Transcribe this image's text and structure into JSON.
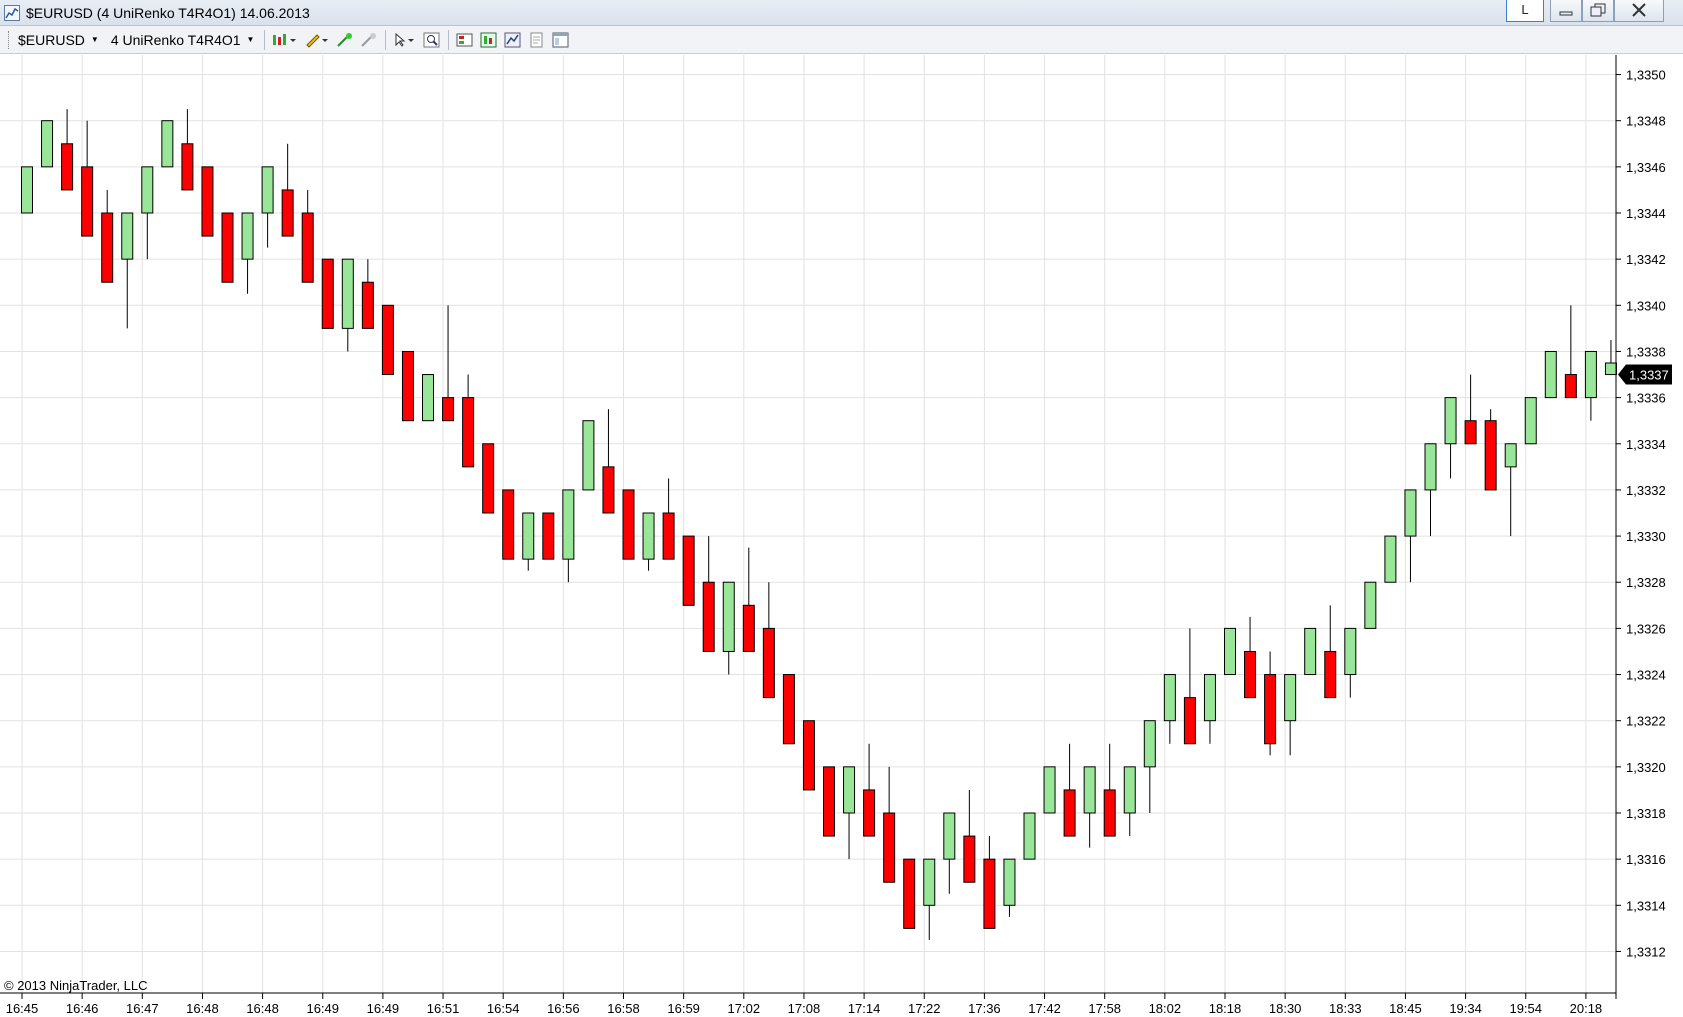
{
  "window": {
    "title": "$EURUSD (4 UniRenko T4R4O1)  14.06.2013",
    "buttons": {
      "layout": "L"
    }
  },
  "toolbar": {
    "instrument": "$EURUSD",
    "bar_type": "4 UniRenko T4R4O1",
    "icons": [
      "bar-style-icon",
      "drawing-pencil-icon",
      "add-marker-icon",
      "remove-marker-icon",
      "pointer-icon",
      "zoom-icon",
      "data-box-icon",
      "strategies-icon",
      "indicators-icon",
      "properties-icon",
      "layout-icon"
    ]
  },
  "footer": {
    "copyright": "© 2013 NinjaTrader, LLC"
  },
  "colors": {
    "up": "#99e699",
    "down": "#ff0000",
    "grid": "#e2e2e2",
    "last_price_bg": "#000000",
    "last_price_text": "#ffffff"
  },
  "chart_data": {
    "type": "candlestick",
    "ylim": [
      1.33115,
      1.33505
    ],
    "y_ticks": [
      "1,3312",
      "1,3314",
      "1,3316",
      "1,3318",
      "1,3320",
      "1,3322",
      "1,3324",
      "1,3326",
      "1,3328",
      "1,3330",
      "1,3332",
      "1,3334",
      "1,3336",
      "1,3338",
      "1,3340",
      "1,3342",
      "1,3344",
      "1,3346",
      "1,3348",
      "1,3350"
    ],
    "x_labels": [
      "16:45",
      "16:46",
      "16:47",
      "16:48",
      "16:48",
      "16:49",
      "16:49",
      "16:51",
      "16:54",
      "16:56",
      "16:58",
      "16:59",
      "17:02",
      "17:08",
      "17:14",
      "17:22",
      "17:36",
      "17:42",
      "17:58",
      "18:02",
      "18:18",
      "18:30",
      "18:33",
      "18:45",
      "19:34",
      "19:54",
      "20:18"
    ],
    "last_price": "1,3337",
    "last_price_value": 1.3337,
    "candles": [
      [
        1.3344,
        1.3346,
        1.3344,
        1.3346
      ],
      [
        1.3346,
        1.3348,
        1.3346,
        1.3348
      ],
      [
        1.3347,
        1.33485,
        1.3345,
        1.3345
      ],
      [
        1.3346,
        1.3348,
        1.3343,
        1.3343
      ],
      [
        1.3344,
        1.3345,
        1.3341,
        1.3341
      ],
      [
        1.3342,
        1.3344,
        1.3339,
        1.3344
      ],
      [
        1.3344,
        1.3346,
        1.3342,
        1.3346
      ],
      [
        1.3346,
        1.3348,
        1.3346,
        1.3348
      ],
      [
        1.3347,
        1.33485,
        1.3345,
        1.3345
      ],
      [
        1.3346,
        1.3346,
        1.3343,
        1.3343
      ],
      [
        1.3344,
        1.3344,
        1.3341,
        1.3341
      ],
      [
        1.3342,
        1.3344,
        1.33405,
        1.3344
      ],
      [
        1.3344,
        1.3346,
        1.33425,
        1.3346
      ],
      [
        1.3345,
        1.3347,
        1.3343,
        1.3343
      ],
      [
        1.3344,
        1.3345,
        1.3341,
        1.3341
      ],
      [
        1.3342,
        1.3342,
        1.3339,
        1.3339
      ],
      [
        1.3339,
        1.3342,
        1.3338,
        1.3342
      ],
      [
        1.3341,
        1.3342,
        1.3339,
        1.3339
      ],
      [
        1.334,
        1.334,
        1.3337,
        1.3337
      ],
      [
        1.3338,
        1.3338,
        1.3335,
        1.3335
      ],
      [
        1.3335,
        1.3337,
        1.3335,
        1.3337
      ],
      [
        1.3336,
        1.334,
        1.3335,
        1.3335
      ],
      [
        1.3336,
        1.3337,
        1.3333,
        1.3333
      ],
      [
        1.3334,
        1.3334,
        1.3331,
        1.3331
      ],
      [
        1.3332,
        1.3332,
        1.3329,
        1.3329
      ],
      [
        1.3329,
        1.3331,
        1.33285,
        1.3331
      ],
      [
        1.3331,
        1.3331,
        1.3329,
        1.3329
      ],
      [
        1.3329,
        1.3332,
        1.3328,
        1.3332
      ],
      [
        1.3332,
        1.3335,
        1.3332,
        1.3335
      ],
      [
        1.3333,
        1.33355,
        1.3331,
        1.3331
      ],
      [
        1.3332,
        1.3332,
        1.3329,
        1.3329
      ],
      [
        1.3329,
        1.3331,
        1.33285,
        1.3331
      ],
      [
        1.3331,
        1.33325,
        1.3329,
        1.3329
      ],
      [
        1.333,
        1.333,
        1.3327,
        1.3327
      ],
      [
        1.3328,
        1.333,
        1.3325,
        1.3325
      ],
      [
        1.3325,
        1.3328,
        1.3324,
        1.3328
      ],
      [
        1.3327,
        1.33295,
        1.3325,
        1.3325
      ],
      [
        1.3326,
        1.3328,
        1.3323,
        1.3323
      ],
      [
        1.3324,
        1.3324,
        1.3321,
        1.3321
      ],
      [
        1.3322,
        1.3322,
        1.3319,
        1.3319
      ],
      [
        1.332,
        1.332,
        1.3317,
        1.3317
      ],
      [
        1.3318,
        1.332,
        1.3316,
        1.332
      ],
      [
        1.3319,
        1.3321,
        1.3317,
        1.3317
      ],
      [
        1.3318,
        1.332,
        1.3315,
        1.3315
      ],
      [
        1.3316,
        1.3316,
        1.3313,
        1.3313
      ],
      [
        1.3314,
        1.3316,
        1.33125,
        1.3316
      ],
      [
        1.3316,
        1.3318,
        1.33145,
        1.3318
      ],
      [
        1.3317,
        1.3319,
        1.3315,
        1.3315
      ],
      [
        1.3316,
        1.3317,
        1.3313,
        1.3313
      ],
      [
        1.3314,
        1.3316,
        1.33135,
        1.3316
      ],
      [
        1.3316,
        1.3318,
        1.3316,
        1.3318
      ],
      [
        1.3318,
        1.332,
        1.3318,
        1.332
      ],
      [
        1.3319,
        1.3321,
        1.3317,
        1.3317
      ],
      [
        1.3318,
        1.332,
        1.33165,
        1.332
      ],
      [
        1.3319,
        1.3321,
        1.3317,
        1.3317
      ],
      [
        1.3318,
        1.332,
        1.3317,
        1.332
      ],
      [
        1.332,
        1.3322,
        1.3318,
        1.3322
      ],
      [
        1.3322,
        1.3324,
        1.3321,
        1.3324
      ],
      [
        1.3323,
        1.3326,
        1.3321,
        1.3321
      ],
      [
        1.3322,
        1.3324,
        1.3321,
        1.3324
      ],
      [
        1.3324,
        1.3326,
        1.3324,
        1.3326
      ],
      [
        1.3325,
        1.33265,
        1.3323,
        1.3323
      ],
      [
        1.3324,
        1.3325,
        1.33205,
        1.3321
      ],
      [
        1.3322,
        1.3324,
        1.33205,
        1.3324
      ],
      [
        1.3324,
        1.3326,
        1.3324,
        1.3326
      ],
      [
        1.3325,
        1.3327,
        1.3323,
        1.3323
      ],
      [
        1.3324,
        1.3326,
        1.3323,
        1.3326
      ],
      [
        1.3326,
        1.3328,
        1.3326,
        1.3328
      ],
      [
        1.3328,
        1.333,
        1.3328,
        1.333
      ],
      [
        1.333,
        1.3332,
        1.3328,
        1.3332
      ],
      [
        1.3332,
        1.3334,
        1.333,
        1.3334
      ],
      [
        1.3334,
        1.3336,
        1.33325,
        1.3336
      ],
      [
        1.3335,
        1.3337,
        1.3334,
        1.3334
      ],
      [
        1.3335,
        1.33355,
        1.3332,
        1.3332
      ],
      [
        1.3333,
        1.3334,
        1.333,
        1.3334
      ],
      [
        1.3334,
        1.3336,
        1.3334,
        1.3336
      ],
      [
        1.3336,
        1.3338,
        1.3336,
        1.3338
      ],
      [
        1.3337,
        1.334,
        1.3336,
        1.3336
      ],
      [
        1.3336,
        1.3338,
        1.3335,
        1.3338
      ],
      [
        1.3337,
        1.33385,
        1.3337,
        1.33375
      ]
    ]
  }
}
